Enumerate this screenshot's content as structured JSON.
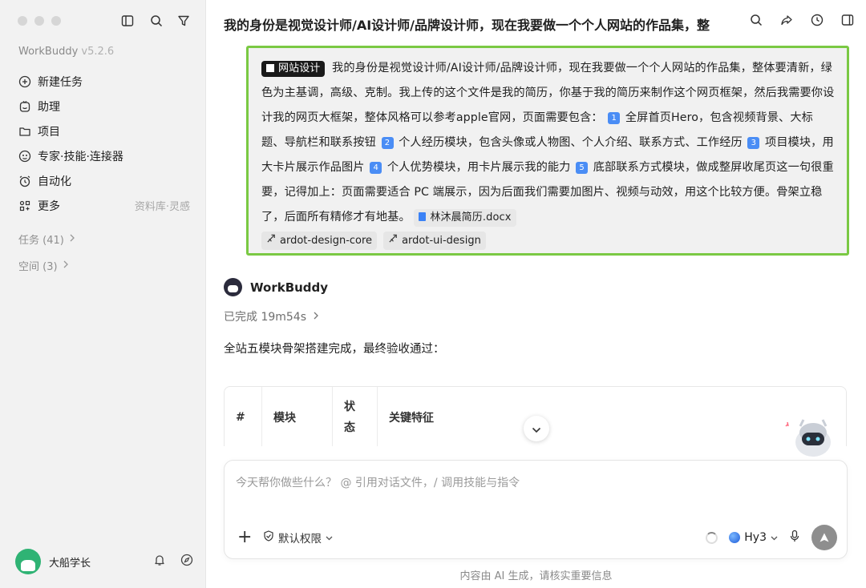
{
  "sidebar": {
    "app_name": "WorkBuddy",
    "version": "v5.2.6",
    "nav": [
      {
        "label": "新建任务",
        "icon": "plus-circle-icon"
      },
      {
        "label": "助理",
        "icon": "assistant-icon"
      },
      {
        "label": "项目",
        "icon": "folder-icon"
      },
      {
        "label": "专家·技能·连接器",
        "icon": "expert-icon"
      },
      {
        "label": "自动化",
        "icon": "alarm-icon"
      },
      {
        "label": "更多",
        "icon": "grid-icon",
        "extra": "资料库·灵感"
      }
    ],
    "tasks_label": "任务 (41)",
    "spaces_label": "空间 (3)",
    "user_name": "大船学长"
  },
  "header": {
    "title": "我的身份是视觉设计师/AI设计师/品牌设计师，现在我要做一个个人网站的作品集，整"
  },
  "user_message": {
    "tag": "网站设计",
    "segments": [
      "我的身份是视觉设计师/AI设计师/品牌设计师，现在我要做一个个人网站的作品集，整体要清新，绿色为主基调，高级、克制。我上传的这个文件是我的简历，你基于我的简历来制作这个网页框架，然后我需要你设计我的网页大框架，整体风格可以参考apple官网，页面需要包含：",
      "全屏首页Hero，包含视频背景、大标题、导航栏和联系按钮",
      "个人经历模块，包含头像或人物图、个人介绍、联系方式、工作经历",
      "项目模块，用大卡片展示作品图片",
      "个人优势模块，用卡片展示我的能力",
      "底部联系方式模块，做成整屏收尾页这一句很重要，记得加上：页面需要适合 PC 端展示，因为后面我们需要加图片、视频与动效，用这个比较方便。骨架立稳了，后面所有精修才有地基。"
    ],
    "nums": [
      "1",
      "2",
      "3",
      "4",
      "5"
    ],
    "file": "林沐晨简历.docx",
    "skills": [
      "ardot-design-core",
      "ardot-ui-design"
    ]
  },
  "bot": {
    "name": "WorkBuddy",
    "status": "已完成 19m54s",
    "summary": "全站五模块骨架搭建完成，最终验收通过：",
    "table_headers": [
      "#",
      "模块",
      "状\n态",
      "关键特征"
    ]
  },
  "composer": {
    "placeholder": "今天帮你做些什么？ @ 引用对话文件，/ 调用技能与指令",
    "permission": "默认权限",
    "model": "Hy3"
  },
  "footer_note": "内容由 AI 生成，请核实重要信息",
  "colors": {
    "highlight": "#7ac943",
    "sidebar_bg": "#f2f2f2"
  }
}
